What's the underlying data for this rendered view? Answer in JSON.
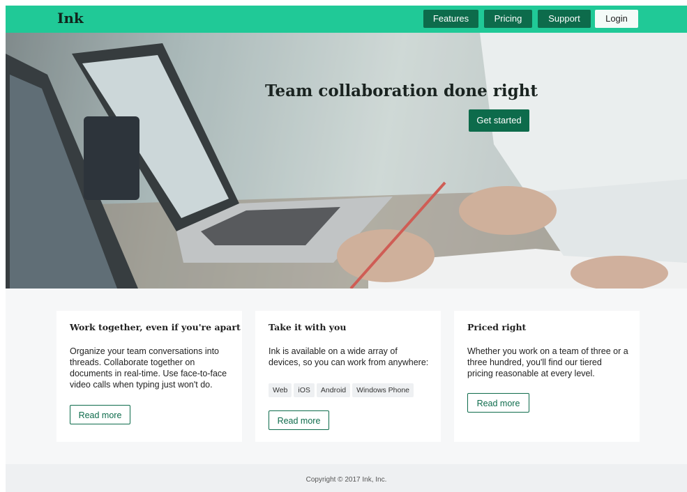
{
  "header": {
    "brand": "Ink",
    "nav": [
      {
        "label": "Features"
      },
      {
        "label": "Pricing"
      },
      {
        "label": "Support"
      },
      {
        "label": "Login"
      }
    ]
  },
  "hero": {
    "title": "Team collaboration done right",
    "cta_label": "Get started"
  },
  "features": [
    {
      "title": "Work together, even if you're apart",
      "body": "Organize your team conversations into threads. Collaborate together on documents in real-time. Use face-to-face video calls when typing just won't do.",
      "button": "Read more"
    },
    {
      "title": "Take it with you",
      "body": "Ink is available on a wide array of devices, so you can work from anywhere:",
      "tags": [
        "Web",
        "iOS",
        "Android",
        "Windows Phone"
      ],
      "button": "Read more"
    },
    {
      "title": "Priced right",
      "body": "Whether you work on a team of three or a three hundred, you'll find our tiered pricing reasonable at every level.",
      "button": "Read more"
    }
  ],
  "footer": {
    "copyright": "Copyright © 2017 Ink, Inc."
  },
  "colors": {
    "header_bg": "#20c997",
    "primary": "#0d6b4b",
    "section_bg": "#f6f7f8"
  }
}
